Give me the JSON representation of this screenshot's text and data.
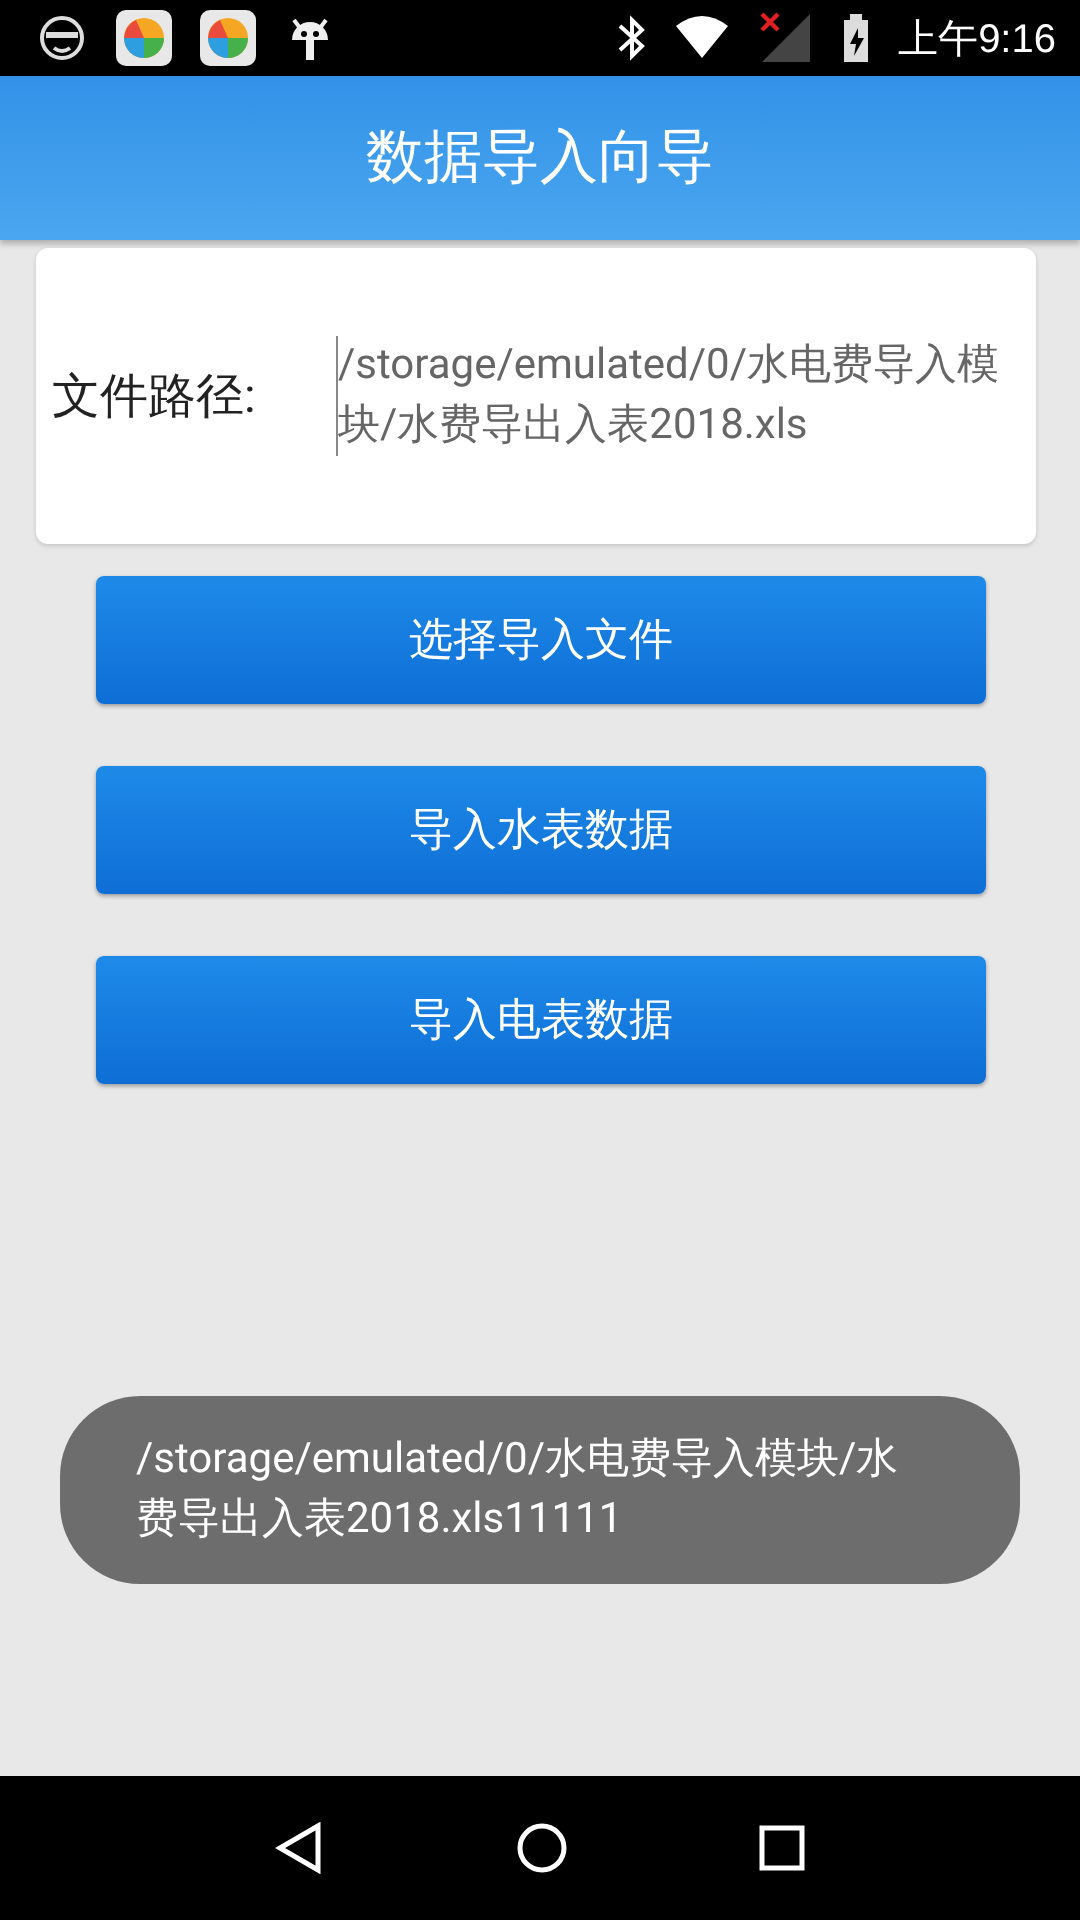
{
  "status_bar": {
    "time": "上午9:16",
    "wifi_connected": true,
    "mobile_no_signal": true,
    "battery_charging": true
  },
  "app_bar": {
    "title": "数据导入向导"
  },
  "file_path": {
    "label": "文件路径:",
    "value": "/storage/emulated/0/水电费导入模块/水费导出入表2018.xls"
  },
  "buttons": [
    {
      "label": "选择导入文件"
    },
    {
      "label": "导入水表数据"
    },
    {
      "label": "导入电表数据"
    }
  ],
  "toast": {
    "text": "/storage/emulated/0/水电费导入模块/水费导出入表2018.xls11111"
  }
}
